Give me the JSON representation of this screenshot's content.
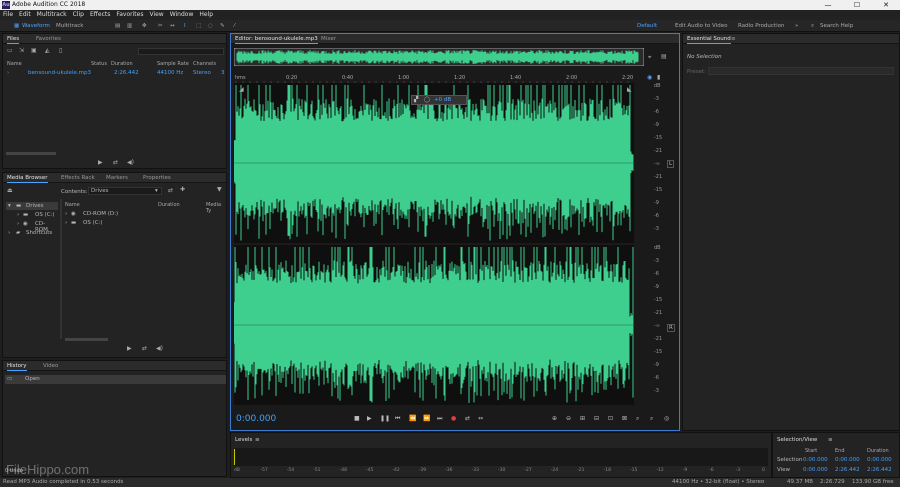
{
  "app": {
    "title": "Adobe Audition CC 2018",
    "logo_text": "Au",
    "min": "—",
    "max": "☐",
    "close": "✕"
  },
  "menu": [
    "File",
    "Edit",
    "Multitrack",
    "Clip",
    "Effects",
    "Favorites",
    "View",
    "Window",
    "Help"
  ],
  "toolbar": {
    "waveform": "Waveform",
    "multitrack": "Multitrack",
    "workspaces": [
      "Default",
      "Edit Audio to Video",
      "Radio Production"
    ],
    "search_placeholder": "Search Help"
  },
  "files_panel": {
    "tabs": [
      "Files",
      "Favorites"
    ],
    "columns": [
      "Name",
      "Status",
      "Duration",
      "Sample Rate",
      "Channels"
    ],
    "rows": [
      {
        "name": "bensound-ukulele.mp3",
        "duration": "2:26.442",
        "rate": "44100 Hz",
        "channels": "Stereo",
        "extra": "3"
      }
    ]
  },
  "media_browser": {
    "tabs": [
      "Media Browser",
      "Effects Rack",
      "Markers",
      "Properties"
    ],
    "contents_label": "Contents:",
    "contents_value": "Drives",
    "tree": [
      "Drives",
      "OS (C:)",
      "CD-ROM",
      "Shortcuts"
    ],
    "columns": [
      "Name",
      "Duration",
      "Media Ty"
    ],
    "items": [
      "CD-ROM (D:)",
      "OS (C:)"
    ]
  },
  "history": {
    "tabs": [
      "History",
      "Video"
    ],
    "items": [
      "Open"
    ],
    "undo_text": "0 Undo"
  },
  "editor": {
    "tab": "Editor: bensound-ukulele.mp3",
    "mixer": "Mixer",
    "ruler": [
      "hms",
      "0:20",
      "0:40",
      "1:00",
      "1:20",
      "1:40",
      "2:00",
      "2:20"
    ],
    "db_labels": [
      "dB",
      "-3",
      "-6",
      "-9",
      "-15",
      "-21",
      "-∞",
      "-21",
      "-15",
      "-9",
      "-6",
      "-3"
    ],
    "hud": "+0 dB",
    "time": "0:00.000",
    "channel_l": "L",
    "channel_r": "R",
    "wave_color": "#3ecf8e"
  },
  "essential": {
    "title": "Essential Sound",
    "no_selection": "No Selection",
    "preset": "Preset:"
  },
  "levels": {
    "title": "Levels",
    "ticks": [
      "dB",
      "-57",
      "-54",
      "-51",
      "-48",
      "-45",
      "-42",
      "-39",
      "-36",
      "-33",
      "-30",
      "-27",
      "-24",
      "-21",
      "-18",
      "-15",
      "-12",
      "-9",
      "-6",
      "-3",
      "0"
    ]
  },
  "selview": {
    "title": "Selection/View",
    "cols": [
      "Start",
      "End",
      "Duration"
    ],
    "selection_label": "Selection",
    "view_label": "View",
    "selection": [
      "0:00.000",
      "0:00.000",
      "0:00.000"
    ],
    "view": [
      "0:00.000",
      "2:26.442",
      "2:26.442"
    ]
  },
  "status": {
    "left": "Read MP3 Audio completed in 0.53 seconds",
    "right": [
      "44100 Hz • 32-bit (float) • Stereo",
      "49.37 MB",
      "2:26.729",
      "133.90 GB free"
    ]
  },
  "watermark": "FileHippo.com"
}
